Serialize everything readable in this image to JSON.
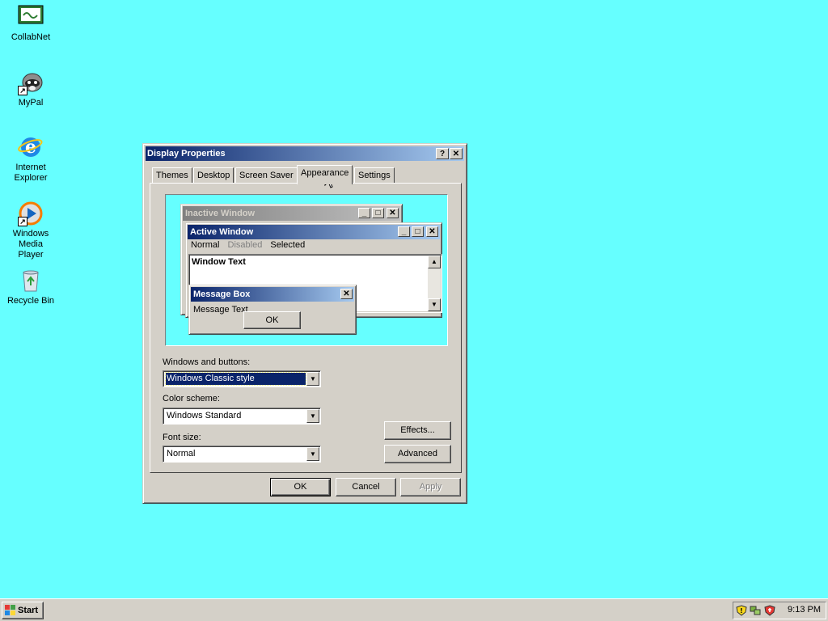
{
  "desktop": {
    "icons": [
      {
        "label": "CollabNet"
      },
      {
        "label": "MyPal"
      },
      {
        "label_line1": "Internet",
        "label_line2": "Explorer"
      },
      {
        "label_line1": "Windows Media",
        "label_line2": "Player"
      },
      {
        "label": "Recycle Bin"
      }
    ],
    "background_color": "#66ffff"
  },
  "dialog": {
    "title": "Display Properties",
    "help_button": "?",
    "close_button": "✕",
    "tabs": [
      {
        "label": "Themes"
      },
      {
        "label": "Desktop"
      },
      {
        "label": "Screen Saver"
      },
      {
        "label": "Appearance",
        "active": true
      },
      {
        "label": "Settings"
      }
    ],
    "preview": {
      "inactive_window_title": "Inactive Window",
      "active_window_title": "Active Window",
      "menu_normal": "Normal",
      "menu_disabled": "Disabled",
      "menu_selected": "Selected",
      "window_text": "Window Text",
      "message_box_title": "Message Box",
      "message_text": "Message Text",
      "ok_label": "OK"
    },
    "windows_buttons_label": "Windows and buttons:",
    "windows_buttons_value": "Windows Classic style",
    "color_scheme_label": "Color scheme:",
    "color_scheme_value": "Windows Standard",
    "font_size_label": "Font size:",
    "font_size_value": "Normal",
    "effects_button": "Effects...",
    "advanced_button": "Advanced",
    "ok_button": "OK",
    "cancel_button": "Cancel",
    "apply_button": "Apply"
  },
  "taskbar": {
    "start_label": "Start",
    "clock": "9:13 PM"
  }
}
